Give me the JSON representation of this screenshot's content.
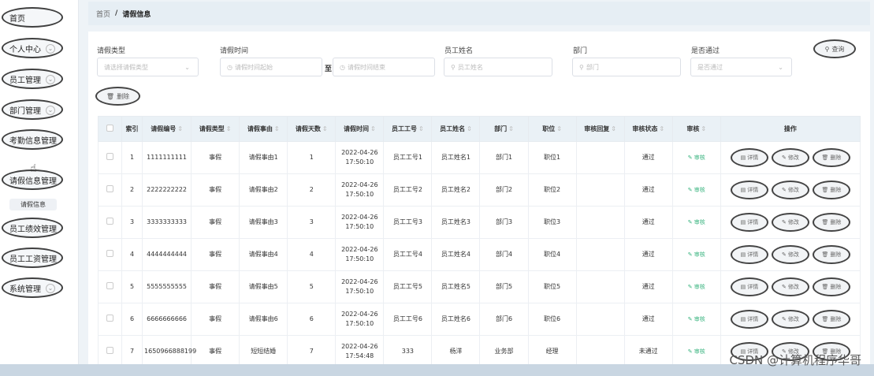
{
  "sidebar": {
    "items": [
      {
        "label": "首页",
        "chevron": false
      },
      {
        "label": "个人中心",
        "chevron": true
      },
      {
        "label": "员工管理",
        "chevron": true
      },
      {
        "label": "部门管理",
        "chevron": true
      },
      {
        "label": "考勤信息管理",
        "chevron": false
      },
      {
        "label": "请假信息管理",
        "chevron": false
      },
      {
        "label": "员工绩效管理",
        "chevron": false
      },
      {
        "label": "员工工资管理",
        "chevron": false
      },
      {
        "label": "系统管理",
        "chevron": true
      }
    ],
    "submenu_label": "请假信息"
  },
  "breadcrumb": {
    "home": "首页",
    "separator": "/",
    "current": "请假信息"
  },
  "filters": {
    "leave_type": {
      "label": "请假类型",
      "placeholder": "请选择请假类型"
    },
    "leave_time": {
      "label": "请假时间",
      "start_placeholder": "请假时间起始",
      "to": "至",
      "end_placeholder": "请假时间结束"
    },
    "employee_name": {
      "label": "员工姓名",
      "placeholder": "员工姓名"
    },
    "department": {
      "label": "部门",
      "placeholder": "部门"
    },
    "passed": {
      "label": "是否通过",
      "placeholder": "是否通过"
    },
    "query_button": "查询",
    "delete_button": "删除"
  },
  "table": {
    "columns": [
      "",
      "索引",
      "请假编号",
      "请假类型",
      "请假事由",
      "请假天数",
      "请假时间",
      "员工工号",
      "员工姓名",
      "部门",
      "职位",
      "审核回复",
      "审核状态",
      "审核",
      "操作"
    ],
    "audit_label": "审核",
    "op_labels": {
      "detail": "详情",
      "edit": "修改",
      "delete": "删除"
    },
    "rows": [
      {
        "index": "1",
        "no": "1111111111",
        "type": "事假",
        "reason": "请假事由1",
        "days": "1",
        "date": "2022-04-26",
        "time": "17:50:10",
        "emp_no": "员工工号1",
        "emp_name": "员工姓名1",
        "dept": "部门1",
        "position": "职位1",
        "reply": "",
        "status": "通过"
      },
      {
        "index": "2",
        "no": "2222222222",
        "type": "事假",
        "reason": "请假事由2",
        "days": "2",
        "date": "2022-04-26",
        "time": "17:50:10",
        "emp_no": "员工工号2",
        "emp_name": "员工姓名2",
        "dept": "部门2",
        "position": "职位2",
        "reply": "",
        "status": "通过"
      },
      {
        "index": "3",
        "no": "3333333333",
        "type": "事假",
        "reason": "请假事由3",
        "days": "3",
        "date": "2022-04-26",
        "time": "17:50:10",
        "emp_no": "员工工号3",
        "emp_name": "员工姓名3",
        "dept": "部门3",
        "position": "职位3",
        "reply": "",
        "status": "通过"
      },
      {
        "index": "4",
        "no": "4444444444",
        "type": "事假",
        "reason": "请假事由4",
        "days": "4",
        "date": "2022-04-26",
        "time": "17:50:10",
        "emp_no": "员工工号4",
        "emp_name": "员工姓名4",
        "dept": "部门4",
        "position": "职位4",
        "reply": "",
        "status": "通过"
      },
      {
        "index": "5",
        "no": "5555555555",
        "type": "事假",
        "reason": "请假事由5",
        "days": "5",
        "date": "2022-04-26",
        "time": "17:50:10",
        "emp_no": "员工工号5",
        "emp_name": "员工姓名5",
        "dept": "部门5",
        "position": "职位5",
        "reply": "",
        "status": "通过"
      },
      {
        "index": "6",
        "no": "6666666666",
        "type": "事假",
        "reason": "请假事由6",
        "days": "6",
        "date": "2022-04-26",
        "time": "17:50:10",
        "emp_no": "员工工号6",
        "emp_name": "员工姓名6",
        "dept": "部门6",
        "position": "职位6",
        "reply": "",
        "status": "通过"
      },
      {
        "index": "7",
        "no": "1650966888199",
        "type": "事假",
        "reason": "短短结婚",
        "days": "7",
        "date": "2022-04-26",
        "time": "17:54:48",
        "emp_no": "333",
        "emp_name": "杨洋",
        "dept": "业务部",
        "position": "经理",
        "reply": "",
        "status": "未通过"
      }
    ]
  },
  "watermark": "CSDN @计算机程序华哥"
}
